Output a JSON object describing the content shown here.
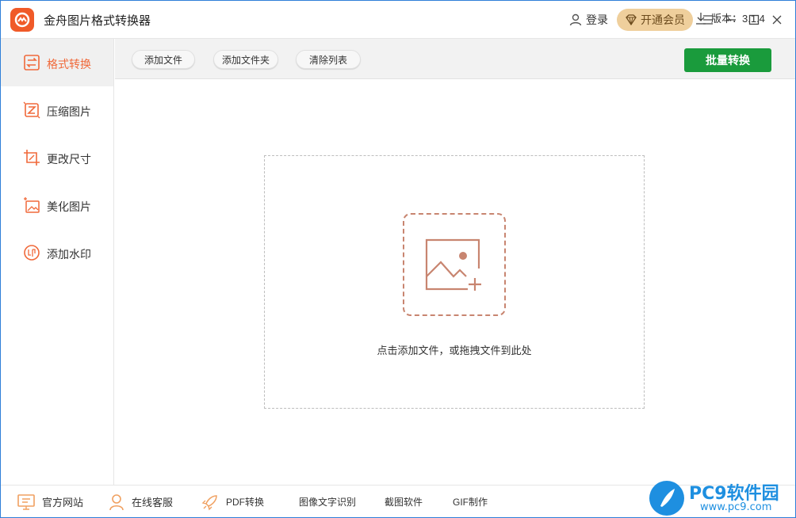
{
  "app": {
    "title": "金舟图片格式转换器"
  },
  "header": {
    "login_label": "登录",
    "vip_label": "开通会员"
  },
  "sidebar": {
    "items": [
      {
        "label": "格式转换",
        "icon": "format-convert-icon",
        "active": true
      },
      {
        "label": "压缩图片",
        "icon": "compress-icon",
        "active": false
      },
      {
        "label": "更改尺寸",
        "icon": "resize-icon",
        "active": false
      },
      {
        "label": "美化图片",
        "icon": "beautify-icon",
        "active": false
      },
      {
        "label": "添加水印",
        "icon": "watermark-icon",
        "active": false
      }
    ]
  },
  "toolbar": {
    "add_file": "添加文件",
    "add_folder": "添加文件夹",
    "clear_list": "清除列表",
    "batch_convert": "批量转换"
  },
  "dropzone": {
    "hint": "点击添加文件，或拖拽文件到此处"
  },
  "footer": {
    "items": [
      {
        "label": "官方网站",
        "icon": "monitor-icon"
      },
      {
        "label": "在线客服",
        "icon": "user-support-icon"
      },
      {
        "label": "PDF转换",
        "icon": "rocket-icon"
      },
      {
        "label": "图像文字识别"
      },
      {
        "label": "截图软件"
      },
      {
        "label": "GIF制作"
      }
    ],
    "version": "版本：3.1.4"
  },
  "watermark": {
    "title": "PC9软件园",
    "url": "www.pc9.com"
  },
  "colors": {
    "accent": "#f0693a",
    "primary_green": "#1a9b3c",
    "vip_gold": "#efcf9c",
    "window_border": "#2f7fd8"
  }
}
